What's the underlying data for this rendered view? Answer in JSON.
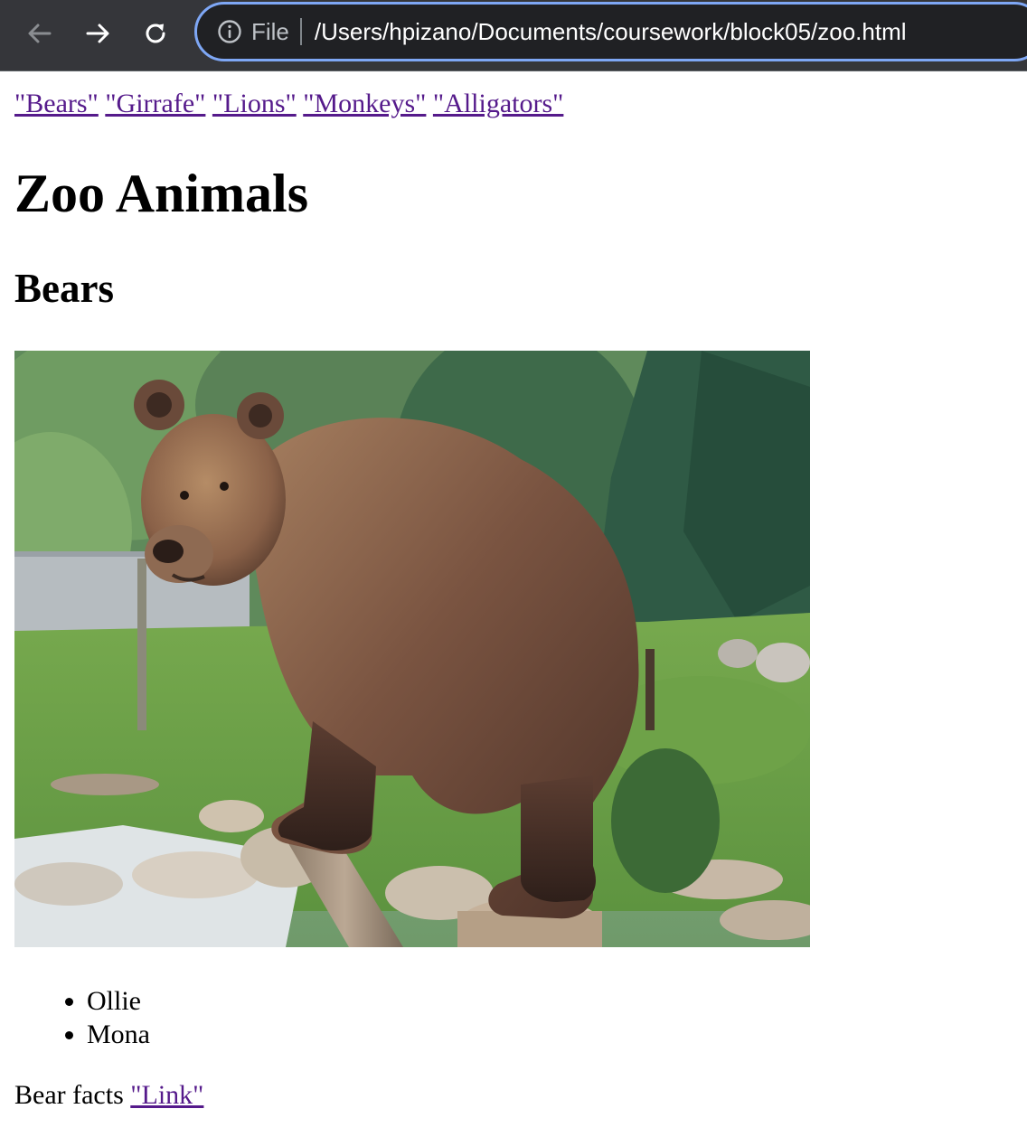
{
  "browser": {
    "scheme_label": "File",
    "url": "/Users/hpizano/Documents/coursework/block05/zoo.html",
    "icons": {
      "back": "arrow-left-icon",
      "forward": "arrow-right-icon",
      "reload": "reload-icon",
      "info": "info-icon"
    },
    "colors": {
      "toolbar": "#35363a",
      "omnibox": "#202124",
      "focus_ring": "#7ea7f5"
    }
  },
  "page": {
    "nav_links": [
      {
        "label": "\"Bears\""
      },
      {
        "label": "\"Girrafe\""
      },
      {
        "label": "\"Lions\""
      },
      {
        "label": "\"Monkeys\""
      },
      {
        "label": "\"Alligators\""
      }
    ],
    "title": "Zoo Animals",
    "section": {
      "heading": "Bears",
      "image_subject": "brown bear standing on a log in a zoo enclosure",
      "names": [
        "Ollie",
        "Mona"
      ],
      "facts_text": "Bear facts",
      "facts_link": "\"Link\""
    },
    "link_color": "#551a8b"
  }
}
